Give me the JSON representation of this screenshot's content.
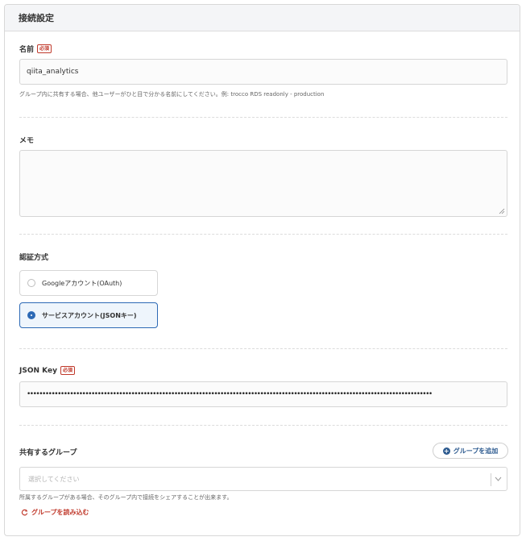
{
  "panel": {
    "title": "接続設定"
  },
  "name_field": {
    "label": "名前",
    "required_badge": "必須",
    "value": "qiita_analytics",
    "help": "グループ内に共有する場合、他ユーザーがひと目で分かる名前にしてください。例: trocco RDS readonly - production"
  },
  "memo_field": {
    "label": "メモ",
    "value": ""
  },
  "auth": {
    "label": "認証方式",
    "options": [
      {
        "label": "Googleアカウント(OAuth)",
        "selected": false
      },
      {
        "label": "サービスアカウント(JSONキー)",
        "selected": true
      }
    ]
  },
  "json_key_field": {
    "label": "JSON Key",
    "required_badge": "必須",
    "value": "••••••••••••••••••••••••••••••••••••••••••••••••••••••••••••••••••••••••••••••••••••••••••••••••••••••••••••••••••••••••••••••••••••"
  },
  "shared_group": {
    "label": "共有するグループ",
    "add_button": "グループを追加",
    "select_placeholder": "選択してください",
    "help": "所属するグループがある場合、そのグループ内で接続をシェアすることが出来ます。",
    "reload_link": "グループを読み込む"
  },
  "colors": {
    "accent": "#2c69b5",
    "required": "#c0392b",
    "button_text": "#2c5a8f"
  },
  "icons": {
    "add": "plus-circle-icon",
    "reload": "refresh-icon",
    "select": "chevron-down-icon",
    "textarea": "resize-handle-icon"
  }
}
